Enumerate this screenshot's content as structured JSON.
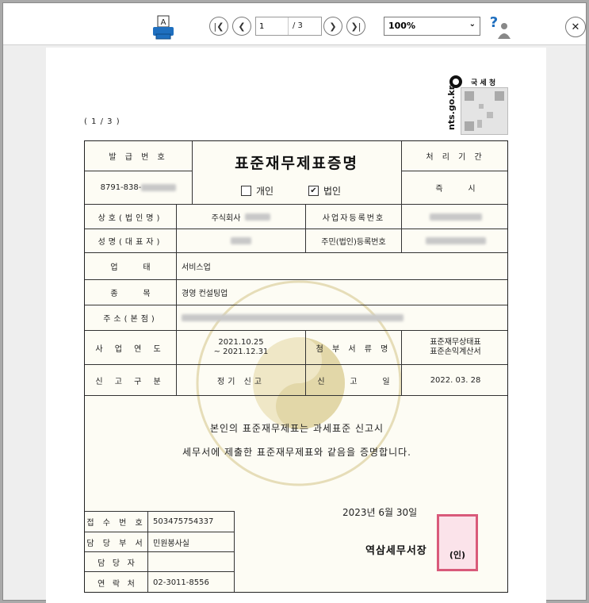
{
  "toolbar": {
    "page_current": "1",
    "page_total": "/ 3",
    "zoom": "100%",
    "icons": {
      "print": "printer-icon",
      "first": "first-page-icon",
      "prev": "prev-page-icon",
      "next": "next-page-icon",
      "last": "last-page-icon",
      "help": "help-icon",
      "close": "close-icon"
    }
  },
  "header": {
    "page_indicator": "( 1 / 3 )",
    "agency": "국 세 청",
    "url": "nts.go.kr"
  },
  "document": {
    "title": "표준재무제표증명",
    "issue_no_label": "발 급 번 호",
    "issue_no_value": "8791-838-",
    "period_label": "처 리 기 간",
    "period_value": "즉          시",
    "type_individual": "개인",
    "type_corporate": "법인",
    "type_corporate_check": "✔",
    "rows": {
      "company_label": "상호(법인명)",
      "company_value": "주식회사",
      "bizno_label": "사업자등록번호",
      "rep_label": "성명(대표자)",
      "resident_label": "주민(법인)등록번호",
      "business_label": "업          태",
      "business_value": "서비스업",
      "item_label": "종          목",
      "item_value": "경영 컨설팅업",
      "address_label": "주소(본점)",
      "fiscal_label": "사 업 연 도",
      "fiscal_start": "2021.10.25",
      "fiscal_end": "~ 2021.12.31",
      "attach_label": "첨 부 서 류 명",
      "attach_1": "표준재무상태표",
      "attach_2": "표준손익계산서",
      "report_type_label": "신 고 구 분",
      "report_type_value": "정기 신고",
      "report_date_label": "신          고          일",
      "report_date_value": "2022. 03. 28"
    },
    "statement_1": "본인의 표준재무제표는 과세표준 신고시",
    "statement_2": "세무서에 제출한 표준재무제표와 같음을 증명합니다.",
    "issue_date": "2023년 6월  30일",
    "office": "역삼세무서장",
    "seal_text": "(인)",
    "info": {
      "receipt_label": "접 수 번 호",
      "receipt_value": "503475754337",
      "dept_label": "담 당 부 서",
      "dept_value": "민원봉사실",
      "officer_label": "담   당   자",
      "officer_value": "",
      "contact_label": "연   락   처",
      "contact_value": "02-3011-8556"
    }
  },
  "colors": {
    "seal": "#d95a7a",
    "paper": "#fdfcf4",
    "watermark": "#e9e0bd"
  }
}
